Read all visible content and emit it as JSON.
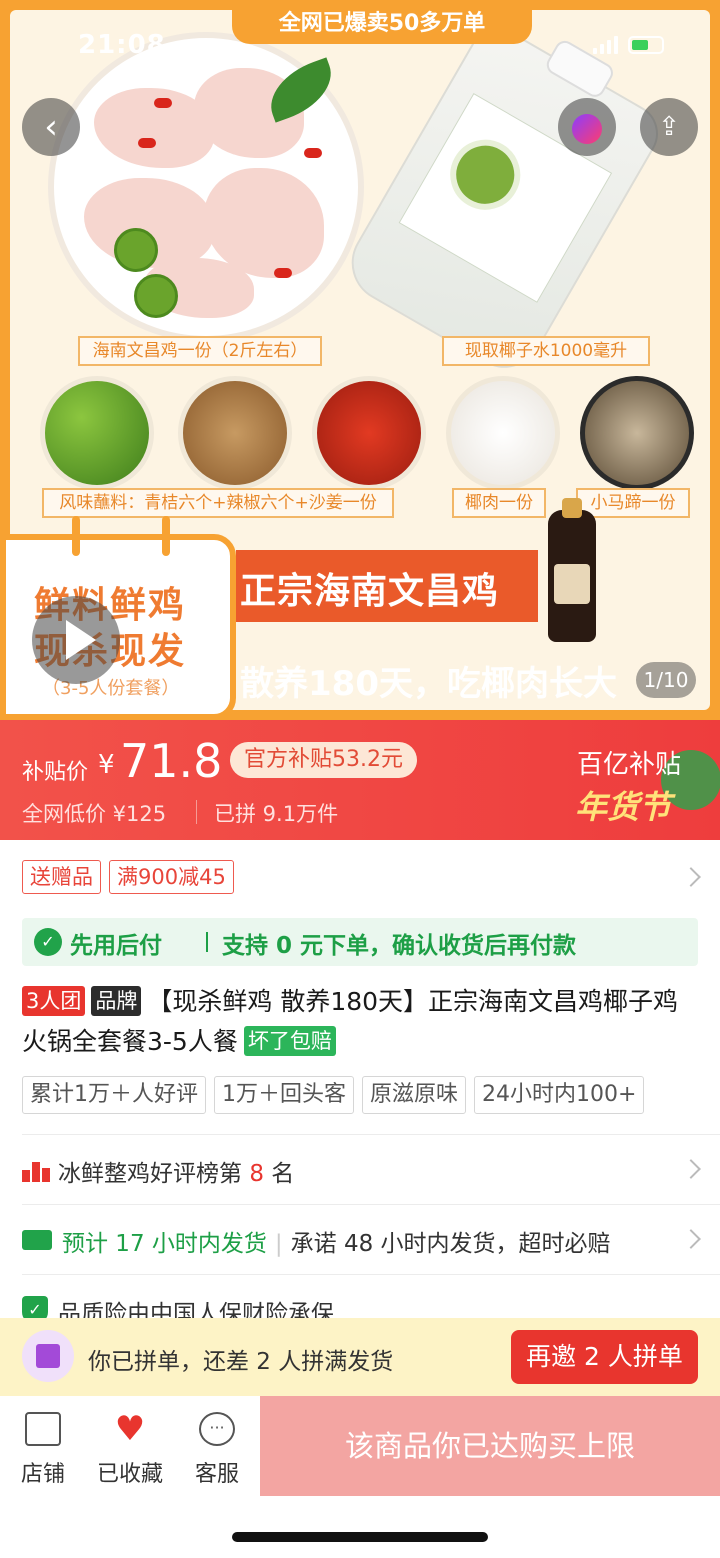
{
  "status_bar": {
    "time": "21:08"
  },
  "hero": {
    "banner": "全网已爆卖50多万单",
    "caption_chicken": "海南文昌鸡一份（2斤左右）",
    "caption_coconut_water": "现取椰子水1000毫升",
    "caption_sauce": "风味蘸料：青桔六个+辣椒六个+沙姜一份",
    "caption_coconut_meat": "椰肉一份",
    "caption_water_chestnut": "小马蹄一份",
    "tag_line1": "鲜料鲜鸡",
    "tag_line2": "现杀现发",
    "tag_line3": "（3-5人份套餐）",
    "headline": "正宗海南文昌鸡",
    "subline": "散养180天，吃椰肉长大",
    "page_indicator": "1/10"
  },
  "price": {
    "label": "补贴价",
    "currency": "¥",
    "value": "71.8",
    "subsidy_badge": "官方补贴53.2元",
    "lowest": "全网低价 ¥125",
    "sold": "已拼 9.1万件",
    "promo_line1": "百亿补贴",
    "promo_line2": "年货节"
  },
  "coupons": [
    "送赠品",
    "满900减45"
  ],
  "pay_later": {
    "title": "先用后付",
    "desc": "支持 0 元下单，确认收货后再付款"
  },
  "product": {
    "badge_group": "3人团",
    "badge_brand": "品牌",
    "title": "【现杀鲜鸡 散养180天】正宗海南文昌鸡椰子鸡火锅全套餐3-5人餐",
    "badge_guarantee": "坏了包赔"
  },
  "chips": [
    "累计1万＋人好评",
    "1万＋回头客",
    "原滋原味",
    "24小时内100+"
  ],
  "ranking": {
    "prefix": "冰鲜整鸡好评榜第 ",
    "rank": "8",
    "suffix": " 名"
  },
  "shipping": {
    "estimate": "预计 17 小时内发货",
    "promise": "承诺 48 小时内发货，超时必赔"
  },
  "insurance": {
    "text": "品质险由中国人保财险承保"
  },
  "group": {
    "text": "你已拼单，还差 2 人拼满发货",
    "button": "再邀 2 人拼单"
  },
  "nav": {
    "store": "店铺",
    "favorited": "已收藏",
    "service": "客服",
    "limit": "该商品你已达购买上限"
  },
  "colors": {
    "accent_red": "#e8352e",
    "hero_orange": "#f7a232",
    "green": "#1d9f46"
  }
}
